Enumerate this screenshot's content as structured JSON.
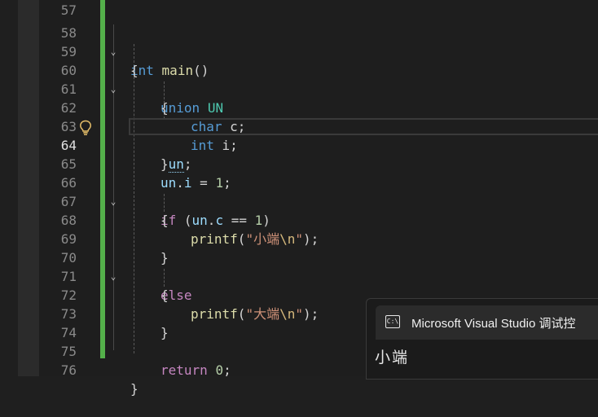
{
  "editor": {
    "partial_top_line_number": "57",
    "lines": [
      {
        "num": "58",
        "fold": "⌄"
      },
      {
        "num": "59",
        "fold": ""
      },
      {
        "num": "60",
        "fold": "⌄"
      },
      {
        "num": "61",
        "fold": ""
      },
      {
        "num": "62",
        "fold": ""
      },
      {
        "num": "63",
        "fold": ""
      },
      {
        "num": "64",
        "fold": ""
      },
      {
        "num": "65",
        "fold": ""
      },
      {
        "num": "66",
        "fold": "⌄"
      },
      {
        "num": "67",
        "fold": ""
      },
      {
        "num": "68",
        "fold": ""
      },
      {
        "num": "69",
        "fold": ""
      },
      {
        "num": "70",
        "fold": "⌄"
      },
      {
        "num": "71",
        "fold": ""
      },
      {
        "num": "72",
        "fold": ""
      },
      {
        "num": "73",
        "fold": ""
      },
      {
        "num": "74",
        "fold": ""
      },
      {
        "num": "75",
        "fold": ""
      },
      {
        "num": "76",
        "fold": ""
      }
    ],
    "code": {
      "l58": {
        "t1": "int",
        "t2": " ",
        "t3": "main",
        "t4": "()"
      },
      "l59": {
        "t1": "{"
      },
      "l60": {
        "t1": "union",
        "t2": " ",
        "t3": "UN"
      },
      "l61": {
        "t1": "{"
      },
      "l62": {
        "t1": "char",
        "t2": " c;"
      },
      "l63": {
        "t1": "int",
        "t2": " i;"
      },
      "l64": {
        "t1": "}",
        "t2": "un",
        "t3": ";"
      },
      "l65": {
        "t1": "un",
        "t2": ".",
        "t3": "i",
        "t4": " = ",
        "t5": "1",
        "t6": ";"
      },
      "l66": {
        "t1": "if",
        "t2": " (",
        "t3": "un",
        "t4": ".",
        "t5": "c",
        "t6": " == ",
        "t7": "1",
        "t8": ")"
      },
      "l67": {
        "t1": "{"
      },
      "l68": {
        "t1": "printf",
        "t2": "(",
        "t3": "\"小端",
        "t4": "\\n",
        "t5": "\"",
        "t6": ");"
      },
      "l69": {
        "t1": "}"
      },
      "l70": {
        "t1": "else"
      },
      "l71": {
        "t1": "{"
      },
      "l72": {
        "t1": "printf",
        "t2": "(",
        "t3": "\"大端",
        "t4": "\\n",
        "t5": "\"",
        "t6": ");"
      },
      "l73": {
        "t1": "}"
      },
      "l75": {
        "t1": "return",
        "t2": " ",
        "t3": "0",
        "t4": ";"
      },
      "l76": {
        "t1": "}"
      }
    },
    "current_line": "64",
    "quick_action_icon": "lightbulb-icon",
    "change_bar_color": "#54b04a"
  },
  "console": {
    "icon": "console-app-icon",
    "icon_text": "C:\\",
    "title": "Microsoft Visual Studio 调试控",
    "close_glyph": "✕",
    "output": "小端"
  }
}
